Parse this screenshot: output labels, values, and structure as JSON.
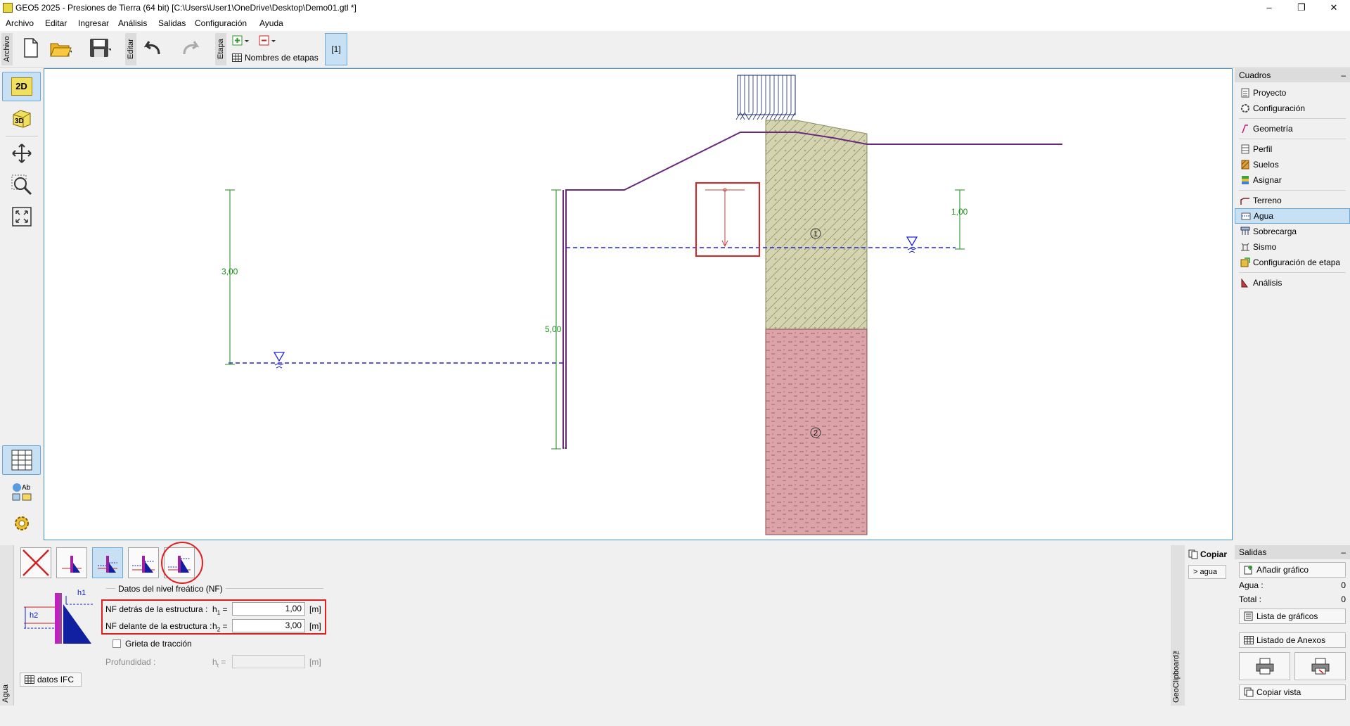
{
  "window": {
    "title": "GEO5 2025 - Presiones de Tierra (64 bit) [C:\\Users\\User1\\OneDrive\\Desktop\\Demo01.gtl *]",
    "minimize": "–",
    "restore": "❐",
    "close": "✕"
  },
  "menu": {
    "items": [
      "Archivo",
      "Editar",
      "Ingresar",
      "Análisis",
      "Salidas",
      "Configuración",
      "Ayuda"
    ]
  },
  "toolbar": {
    "archivo_label": "Archivo",
    "editar_label": "Editar",
    "etapa_label": "Etapa",
    "stage_names_label": "Nombres de etapas",
    "stage_button": "[1]"
  },
  "leftbar": {
    "btn_2d": "2D",
    "btn_3d": "3D"
  },
  "drawing": {
    "dim_left": "3,00",
    "dim_wall": "5,00",
    "dim_right": "1,00",
    "soil_1": "1",
    "soil_2": "2",
    "colors": {
      "wall": "#6a2a7a",
      "water": "#2020e0",
      "dim": "#1a8a1a",
      "soil1": "#d4d4b0",
      "soil2": "#dca4a8",
      "highlight": "#e02020"
    }
  },
  "rightpanel": {
    "title": "Cuadros",
    "collapse": "–",
    "items": [
      {
        "label": "Proyecto",
        "icon": "document-icon"
      },
      {
        "label": "Configuración",
        "icon": "gear-icon"
      },
      {
        "label": "Geometría",
        "icon": "geometry-icon"
      },
      {
        "label": "Perfil",
        "icon": "profile-icon"
      },
      {
        "label": "Suelos",
        "icon": "soils-icon"
      },
      {
        "label": "Asignar",
        "icon": "assign-icon"
      },
      {
        "label": "Terreno",
        "icon": "terrain-icon"
      },
      {
        "label": "Agua",
        "icon": "water-icon"
      },
      {
        "label": "Sobrecarga",
        "icon": "surcharge-icon"
      },
      {
        "label": "Sismo",
        "icon": "earthquake-icon"
      },
      {
        "label": "Configuración de etapa",
        "icon": "stage-config-icon"
      },
      {
        "label": "Análisis",
        "icon": "analysis-icon"
      }
    ]
  },
  "bottom": {
    "side_label": "Agua",
    "group_title": "Datos del nivel freático (NF)",
    "h1_label": "NF detrás de la estructura :",
    "h1_sym": "h",
    "h1_sub": "1",
    "h1_value": "1,00",
    "h1_unit": "[m]",
    "h2_label": "NF delante de la estructura :",
    "h2_sym": "h",
    "h2_sub": "2",
    "h2_value": "3,00",
    "h2_unit": "[m]",
    "crack_label": "Grieta de tracción",
    "depth_label": "Profundidad :",
    "depth_sym": "h",
    "depth_sub": "t",
    "depth_unit": "[m]",
    "ifc_button": "datos IFC",
    "fig_h1": "h1",
    "fig_h2": "h2",
    "equals": "="
  },
  "clipboard": {
    "side_label": "GeoClipboard™",
    "copy": "Copiar",
    "agua": "> agua"
  },
  "salidas": {
    "title": "Salidas",
    "collapse": "–",
    "add_graphic": "Añadir gráfico",
    "agua_label": "Agua :",
    "agua_value": "0",
    "total_label": "Total :",
    "total_value": "0",
    "graphics_list": "Lista de gráficos",
    "annex_list": "Listado de Anexos",
    "copy_view": "Copiar vista"
  }
}
